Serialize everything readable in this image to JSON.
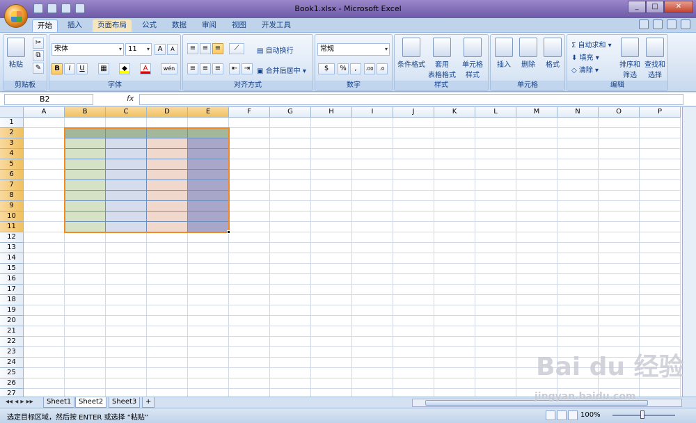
{
  "window": {
    "title": "Book1.xlsx - Microsoft Excel"
  },
  "tabs": [
    "开始",
    "插入",
    "页面布局",
    "公式",
    "数据",
    "审阅",
    "视图",
    "开发工具"
  ],
  "ribbon": {
    "clipboard": {
      "paste": "粘贴",
      "title": "剪贴板"
    },
    "font": {
      "name": "宋体",
      "size": "11",
      "title": "字体",
      "bold": "B",
      "italic": "I",
      "underline": "U",
      "grow": "A",
      "shrink": "A",
      "color_a": "A",
      "wen": "wén"
    },
    "align": {
      "wrap": "自动换行",
      "merge": "合并后居中",
      "title": "对齐方式"
    },
    "number": {
      "format": "常规",
      "title": "数字",
      "percent": "%",
      "comma": ",",
      "inc": ".00",
      "dec": ".0"
    },
    "styles": {
      "cond": "条件格式",
      "table1": "套用",
      "table2": "表格格式",
      "cell1": "单元格",
      "cell2": "样式",
      "title": "样式"
    },
    "cells": {
      "insert": "插入",
      "delete": "删除",
      "format": "格式",
      "title": "单元格"
    },
    "edit": {
      "autosum": "自动求和",
      "fill": "填充",
      "clear": "清除",
      "sort1": "排序和",
      "sort2": "筛选",
      "find1": "查找和",
      "find2": "选择",
      "title": "编辑"
    }
  },
  "formula_bar": {
    "namebox": "B2",
    "fx": "fx"
  },
  "columns": [
    "A",
    "B",
    "C",
    "D",
    "E",
    "F",
    "G",
    "H",
    "I",
    "J",
    "K",
    "L",
    "M",
    "N",
    "O",
    "P"
  ],
  "rows": [
    "1",
    "2",
    "3",
    "4",
    "5",
    "6",
    "7",
    "8",
    "9",
    "10",
    "11",
    "12",
    "13",
    "14",
    "15",
    "16",
    "17",
    "18",
    "19",
    "20",
    "21",
    "22",
    "23",
    "24",
    "25",
    "26",
    "27"
  ],
  "sheets": [
    "Sheet1",
    "Sheet2",
    "Sheet3"
  ],
  "status": {
    "text": "选定目标区域，然后按 ENTER 或选择 “粘贴”",
    "zoom": "100%"
  },
  "colors": {
    "header_row": "#a3b89a",
    "col_B": "#d6e2c5",
    "col_C": "#d5dcec",
    "col_D": "#f1d8cc",
    "col_E": "#a9a7c9",
    "selection": "#f08a24"
  },
  "watermark": {
    "logo": "Bai du 经验",
    "url": "jingyan.baidu.com"
  }
}
